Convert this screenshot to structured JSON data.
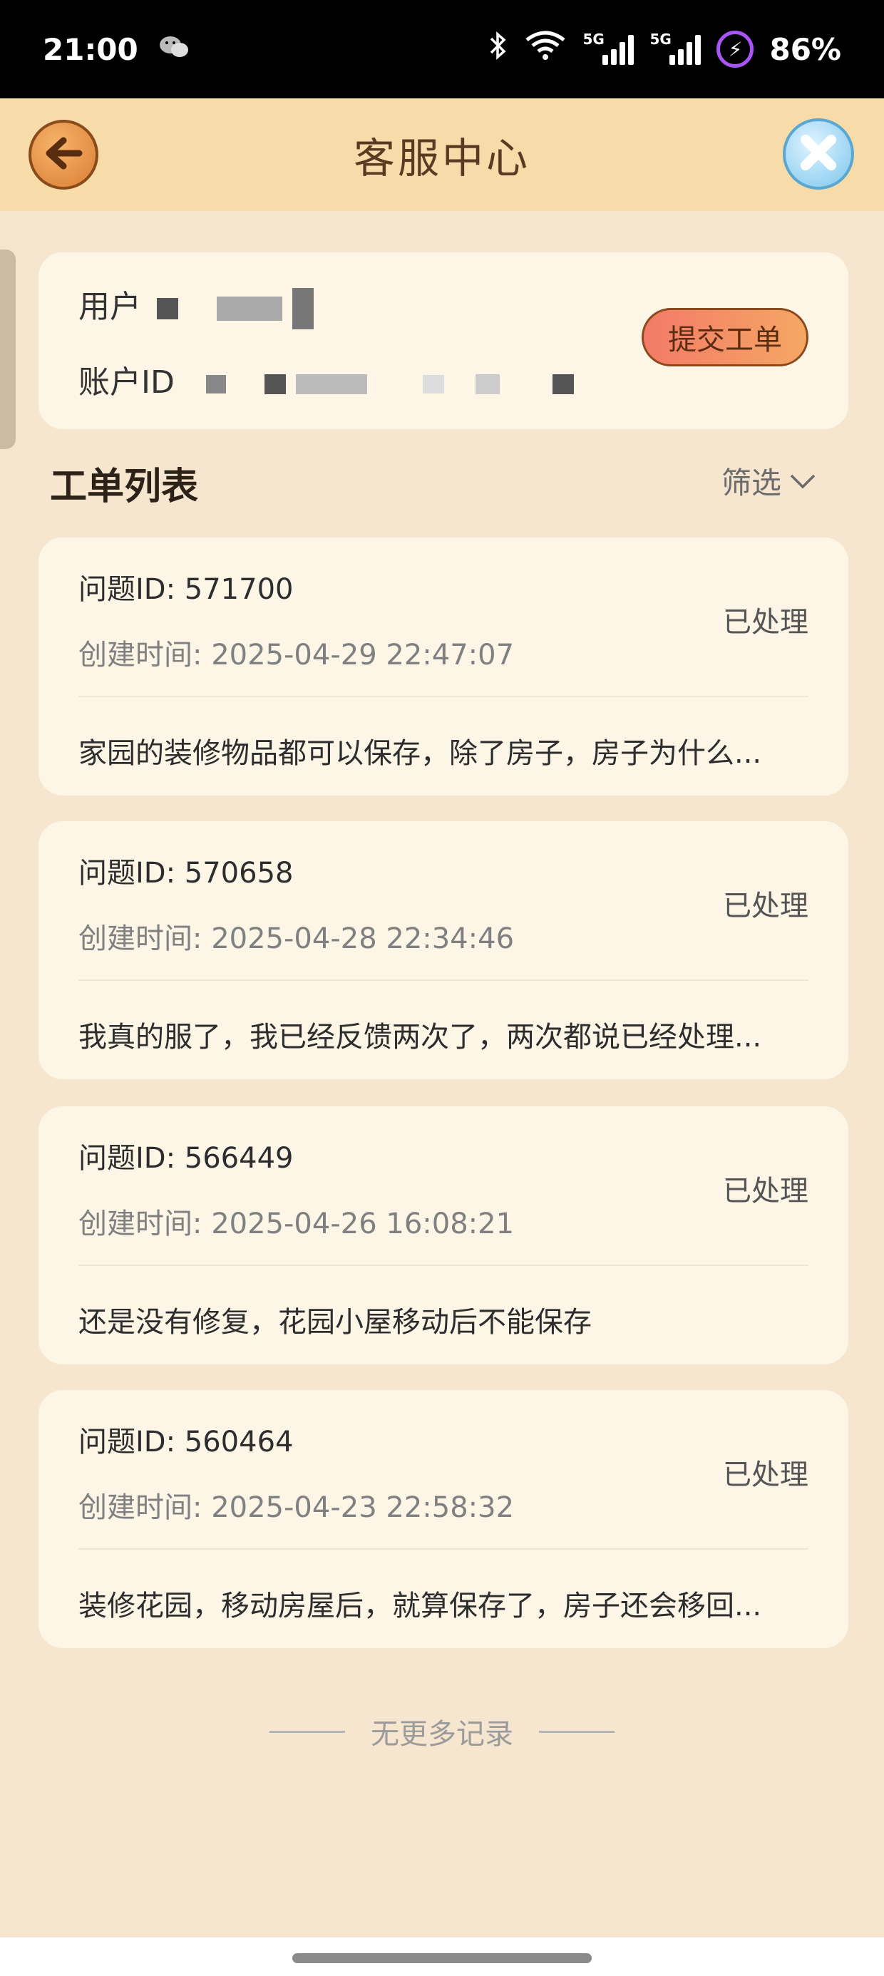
{
  "status_bar": {
    "time": "21:00",
    "network1": "5G",
    "network2": "5G",
    "battery": "86%"
  },
  "header": {
    "title": "客服中心"
  },
  "user_card": {
    "user_label": "用户",
    "account_label": "账户ID",
    "submit_label": "提交工单"
  },
  "ticket_list": {
    "title": "工单列表",
    "filter_label": "筛选",
    "tickets": [
      {
        "id": "问题ID: 571700",
        "time": "创建时间: 2025-04-29 22:47:07",
        "status": "已处理",
        "description": "家园的装修物品都可以保存，除了房子，房子为什么..."
      },
      {
        "id": "问题ID: 570658",
        "time": "创建时间: 2025-04-28 22:34:46",
        "status": "已处理",
        "description": "我真的服了，我已经反馈两次了，两次都说已经处理..."
      },
      {
        "id": "问题ID: 566449",
        "time": "创建时间: 2025-04-26 16:08:21",
        "status": "已处理",
        "description": "还是没有修复，花园小屋移动后不能保存"
      },
      {
        "id": "问题ID: 560464",
        "time": "创建时间: 2025-04-23 22:58:32",
        "status": "已处理",
        "description": "装修花园，移动房屋后，就算保存了，房子还会移回..."
      }
    ],
    "end_text": "无更多记录"
  },
  "colors": {
    "background": "#f7e6cf",
    "header": "#f7dcaa",
    "card": "#fdf5e6",
    "submit_button": "#f37a68"
  },
  "icons": [
    "wechat-icon",
    "bluetooth-icon",
    "wifi-icon",
    "signal-icon",
    "battery-charging-icon",
    "back-arrow-icon",
    "close-icon",
    "chevron-down-icon"
  ]
}
